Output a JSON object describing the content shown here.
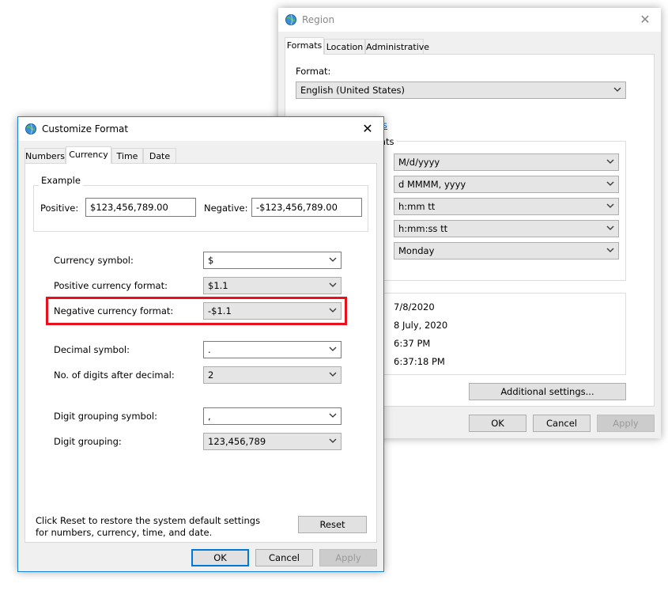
{
  "region": {
    "title": "Region",
    "tabs": [
      "Formats",
      "Location",
      "Administrative"
    ],
    "format_label": "Format:",
    "format_value": "English (United States)",
    "link_fragment": "s",
    "group_fragment": "ats",
    "date_time_combos": [
      "M/d/yyyy",
      "d MMMM, yyyy",
      "h:mm tt",
      "h:mm:ss tt",
      "Monday"
    ],
    "examples": [
      "7/8/2020",
      "8 July, 2020",
      "6:37 PM",
      "6:37:18 PM"
    ],
    "additional_settings": "Additional settings...",
    "ok": "OK",
    "cancel": "Cancel",
    "apply": "Apply"
  },
  "customize": {
    "title": "Customize Format",
    "tabs": [
      "Numbers",
      "Currency",
      "Time",
      "Date"
    ],
    "example": {
      "label": "Example",
      "positive_label": "Positive:",
      "positive_value": "$123,456,789.00",
      "negative_label": "Negative:",
      "negative_value": "-$123,456,789.00"
    },
    "fields": [
      {
        "label": "Currency symbol:",
        "value": "$"
      },
      {
        "label": "Positive currency format:",
        "value": "$1.1"
      },
      {
        "label": "Negative currency format:",
        "value": "-$1.1"
      },
      {
        "label": "Decimal symbol:",
        "value": "."
      },
      {
        "label": "No. of digits after decimal:",
        "value": "2"
      },
      {
        "label": "Digit grouping symbol:",
        "value": ","
      },
      {
        "label": "Digit grouping:",
        "value": "123,456,789"
      }
    ],
    "reset_text": "Click Reset to restore the system default settings for numbers, currency, time, and date.",
    "reset": "Reset",
    "ok": "OK",
    "cancel": "Cancel",
    "apply": "Apply"
  },
  "colors": {
    "highlight": "#e8111b",
    "accent": "#0078d7",
    "link": "#0066cc"
  }
}
